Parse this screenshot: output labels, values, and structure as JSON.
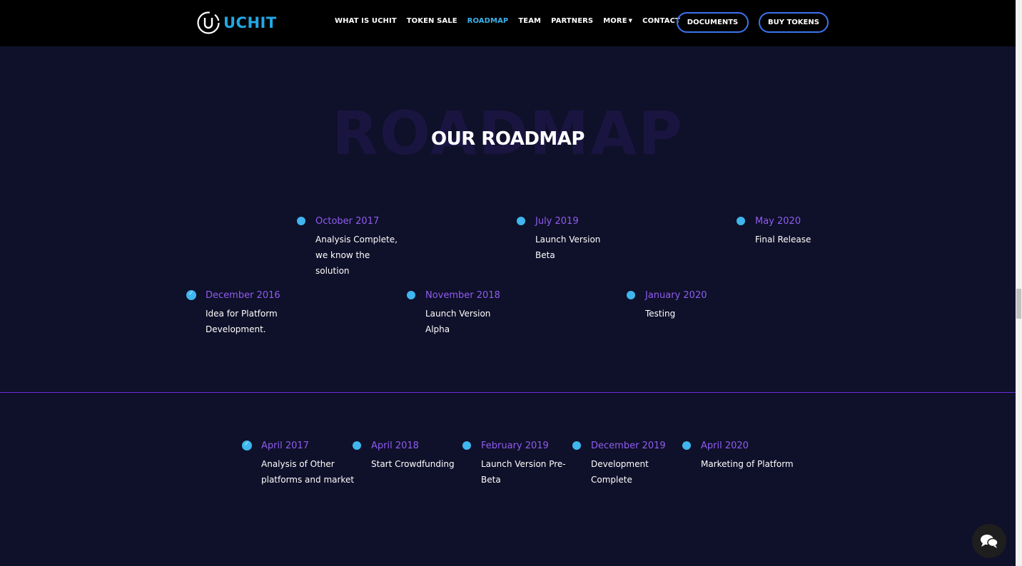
{
  "header": {
    "logo_text": "UCHIT",
    "nav": [
      {
        "label": "WHAT IS UCHIT"
      },
      {
        "label": "TOKEN SALE"
      },
      {
        "label": "ROADMAP"
      },
      {
        "label": "TEAM"
      },
      {
        "label": "PARTNERS"
      },
      {
        "label": "MORE"
      },
      {
        "label": "CONTACT"
      }
    ],
    "documents_label": "DOCUMENTS",
    "buy_tokens_label": "BUY TOKENS"
  },
  "roadmap": {
    "bg_title": "ROADMAP",
    "title": "OUR ROADMAP",
    "upper": [
      {
        "date": "October 2017",
        "text": "Analysis Complete, we know the solution"
      },
      {
        "date": "July 2019",
        "text": "Launch Version Beta"
      },
      {
        "date": "May 2020",
        "text": "Final Release"
      }
    ],
    "lower": [
      {
        "date": "December 2016",
        "text": "Idea for Platform Development."
      },
      {
        "date": "November 2018",
        "text": "Launch Version Alpha"
      },
      {
        "date": "January 2020",
        "text": "Testing"
      }
    ],
    "second_row": [
      {
        "date": "April 2017",
        "text": "Analysis of Other platforms and market"
      },
      {
        "date": "April 2018",
        "text": "Start Crowdfunding"
      },
      {
        "date": "February 2019",
        "text": "Launch Version Pre-Beta"
      },
      {
        "date": "December 2019",
        "text": "Development Complete"
      },
      {
        "date": "April 2020",
        "text": "Marketing of Platform"
      }
    ]
  },
  "colors": {
    "accent": "#3ab2ec",
    "date": "#8f5cf0",
    "background": "#0f1029",
    "divider": "#6d2ee0"
  }
}
